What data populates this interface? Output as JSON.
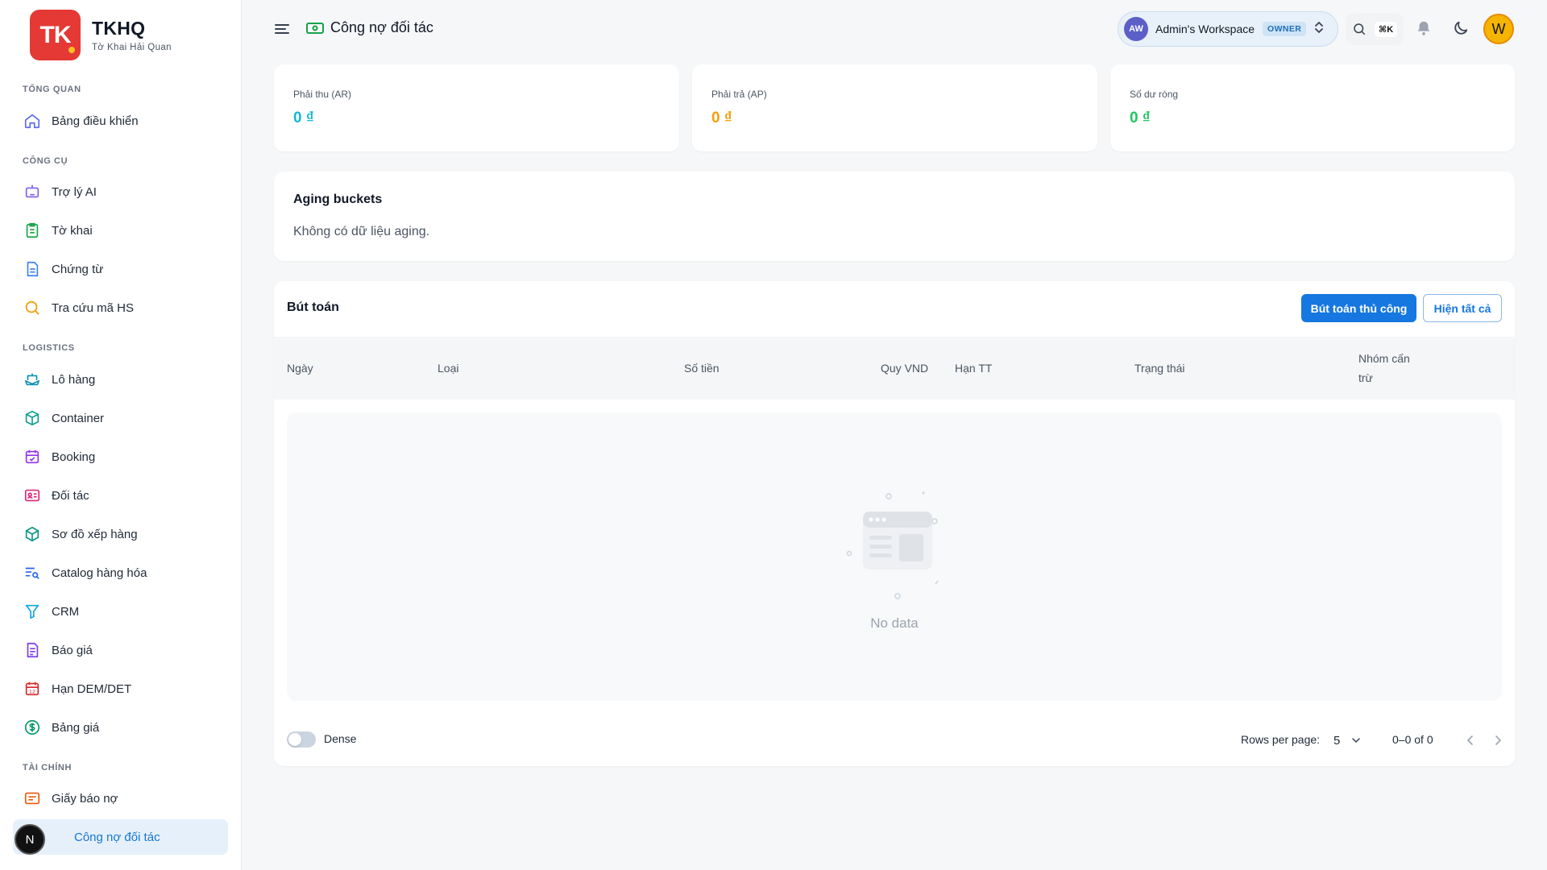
{
  "brand": {
    "logo_text": "TK",
    "title": "TKHQ",
    "subtitle": "Tờ Khai Hải Quan"
  },
  "sidebar": {
    "sections": [
      {
        "label": "TỔNG QUAN",
        "items": [
          {
            "label": "Bảng điều khiển",
            "icon": "home-icon"
          }
        ]
      },
      {
        "label": "CÔNG CỤ",
        "items": [
          {
            "label": "Trợ lý AI",
            "icon": "robot-icon"
          },
          {
            "label": "Tờ khai",
            "icon": "clipboard-icon"
          },
          {
            "label": "Chứng từ",
            "icon": "document-icon"
          },
          {
            "label": "Tra cứu mã HS",
            "icon": "search-icon"
          }
        ]
      },
      {
        "label": "LOGISTICS",
        "items": [
          {
            "label": "Lô hàng",
            "icon": "ship-icon"
          },
          {
            "label": "Container",
            "icon": "box-icon"
          },
          {
            "label": "Booking",
            "icon": "calendar-check-icon"
          },
          {
            "label": "Đối tác",
            "icon": "id-card-icon"
          },
          {
            "label": "Sơ đồ xếp hàng",
            "icon": "cube-icon"
          },
          {
            "label": "Catalog hàng hóa",
            "icon": "list-search-icon"
          },
          {
            "label": "CRM",
            "icon": "funnel-icon"
          },
          {
            "label": "Báo giá",
            "icon": "file-text-icon"
          },
          {
            "label": "Hạn DEM/DET",
            "icon": "calendar-12-icon"
          },
          {
            "label": "Bảng giá",
            "icon": "dollar-circle-icon"
          }
        ]
      },
      {
        "label": "TÀI CHÍNH",
        "items": [
          {
            "label": "Giấy báo nợ",
            "icon": "receipt-icon"
          },
          {
            "label": "Công nợ đối tác",
            "icon": "cash-icon",
            "active": true
          }
        ]
      }
    ],
    "badge": "N"
  },
  "header": {
    "title": "Công nợ đối tác",
    "workspace": {
      "initials": "AW",
      "name": "Admin's Workspace",
      "role": "OWNER"
    },
    "search_shortcut": "⌘K",
    "user_initial": "W"
  },
  "stats": [
    {
      "label": "Phải thu (AR)",
      "value": "0 ₫",
      "color": "#14b8d4"
    },
    {
      "label": "Phải trả (AP)",
      "value": "0 ₫",
      "color": "#f59e0b"
    },
    {
      "label": "Số dư ròng",
      "value": "0 ₫",
      "color": "#22c55e"
    }
  ],
  "aging": {
    "title": "Aging buckets",
    "empty": "Không có dữ liệu aging."
  },
  "journal": {
    "title": "Bút toán",
    "manual_button": "Bút toán thủ công",
    "show_all_button": "Hiện tất cả",
    "columns": [
      "Ngày",
      "Loại",
      "Số tiền",
      "Quy VND",
      "Hạn TT",
      "Trạng thái",
      "Nhóm cấn",
      "trừ"
    ],
    "empty_text": "No data",
    "dense_label": "Dense",
    "rows_per_page_label": "Rows per page:",
    "rows_per_page": "5",
    "page_range": "0–0 of 0"
  }
}
